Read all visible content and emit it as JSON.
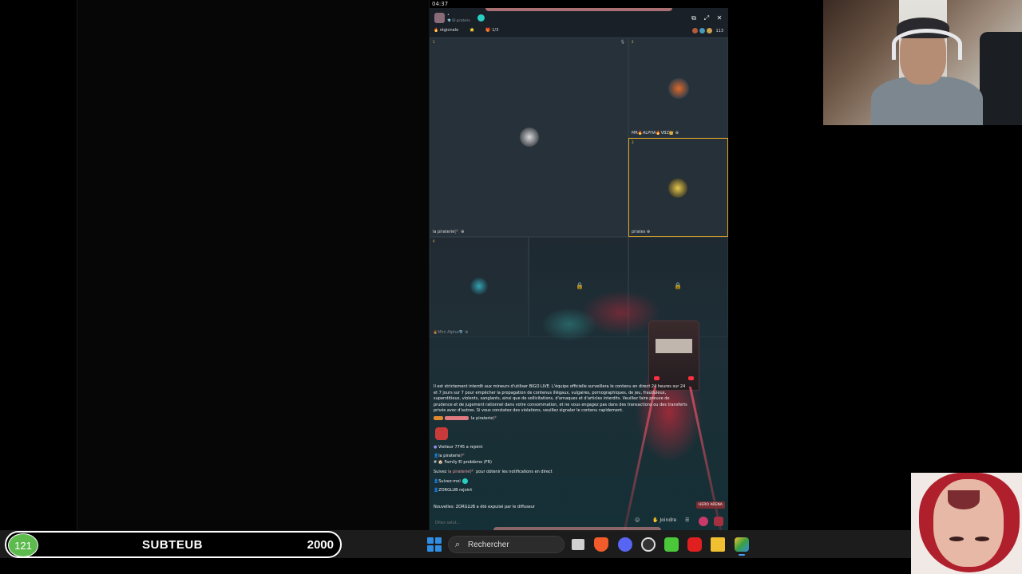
{
  "system": {
    "clock": "04:37"
  },
  "live": {
    "host_name": "•",
    "host_subtitle": "💎 ID piraterie",
    "tags": [
      "🔥 régionale",
      "⭐",
      "🎁 1/3"
    ],
    "viewer_count": "113",
    "slots": [
      {
        "num": "1",
        "label": "la piraterie🏴 ⊕"
      },
      {
        "num": "2",
        "label": "MR🔥ALPHA🔥VBZ👑 ⊕"
      },
      {
        "num": "3",
        "label": "pirates ⊕"
      },
      {
        "num": "4",
        "label": "🔥Mini Alpha💎 ⊕"
      }
    ],
    "notice": "Il est strictement interdit aux mineurs d'utiliser BIGO LIVE. L'équipe officielle surveillera le contenu en direct 24 heures sur 24 et 7 jours sur 7 pour empêcher la propagation de contenus illégaux, vulgaires, pornographiques, de jeu, frauduleux, superstitieux, violents, sanglants, ainsi que de sollicitations, d'arnaques et d'articles interdits. Veuillez faire preuve de prudence et de jugement rationnel dans votre consommation, et ne vous engagez pas dans des transactions ou des transferts privés avec d'autres. Si vous constatez des violations, veuillez signaler le contenu rapidement.",
    "chat": {
      "sender_name": "la piraterie🏴",
      "join_msg": "Visiteur 7745 a rejoint",
      "name_line": "la piraterie🏴",
      "family_line": "# 🏠 Family El problèmo (FR)",
      "follow_prefix": "Suivez",
      "follow_name": "la piraterie🏴",
      "follow_suffix": "pour obtenir les notifications en direct",
      "follow_me": "Suivez-moi",
      "zorg_join": "ZORGLUB rejoint",
      "kick_msg": "Nouvelles: ZORGLUB a été expulsé par le diffuseur"
    },
    "hero_arena": "HERO ARENA",
    "input_placeholder": "Dites salut...",
    "join_label": "Joindre"
  },
  "goal_bar": {
    "current": "121",
    "label": "SUBTEUB",
    "target": "2000",
    "color": "#5dbb4e"
  },
  "taskbar": {
    "search_label": "Rechercher",
    "apps": [
      "file-explorer",
      "brave",
      "discord",
      "obs",
      "game",
      "youtube",
      "folder",
      "layers"
    ]
  }
}
